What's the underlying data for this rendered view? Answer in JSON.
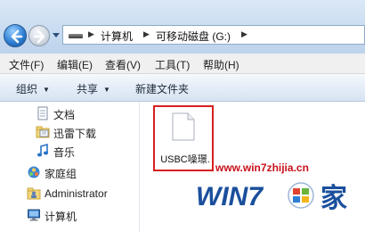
{
  "address": {
    "breadcrumbs": [
      "计算机",
      "可移动磁盘 (G:)"
    ]
  },
  "menu": [
    "文件(F)",
    "编辑(E)",
    "查看(V)",
    "工具(T)",
    "帮助(H)"
  ],
  "toolbar": {
    "organize": "组织",
    "share": "共享",
    "new_folder": "新建文件夹"
  },
  "sidebar": {
    "items": [
      {
        "label": "文档",
        "icon": "document-library-icon"
      },
      {
        "label": "迅雷下载",
        "icon": "folder-download-icon"
      },
      {
        "label": "音乐",
        "icon": "music-note-icon"
      },
      {
        "label": "家庭组",
        "icon": "homegroup-icon"
      },
      {
        "label": "Administrator",
        "icon": "user-folder-icon"
      },
      {
        "label": "计算机",
        "icon": "computer-icon"
      }
    ]
  },
  "files": [
    {
      "name": "USBC噪璟.",
      "icon": "blank-file-icon",
      "highlighted": true
    }
  ],
  "watermark": {
    "url": "www.win7zhijia.cn",
    "logo_text": "WIN7",
    "logo_cn": "家"
  },
  "colors": {
    "highlight_border": "#d71f1f",
    "watermark_red": "#c8101a",
    "watermark_blue": "#1a4f9c"
  }
}
